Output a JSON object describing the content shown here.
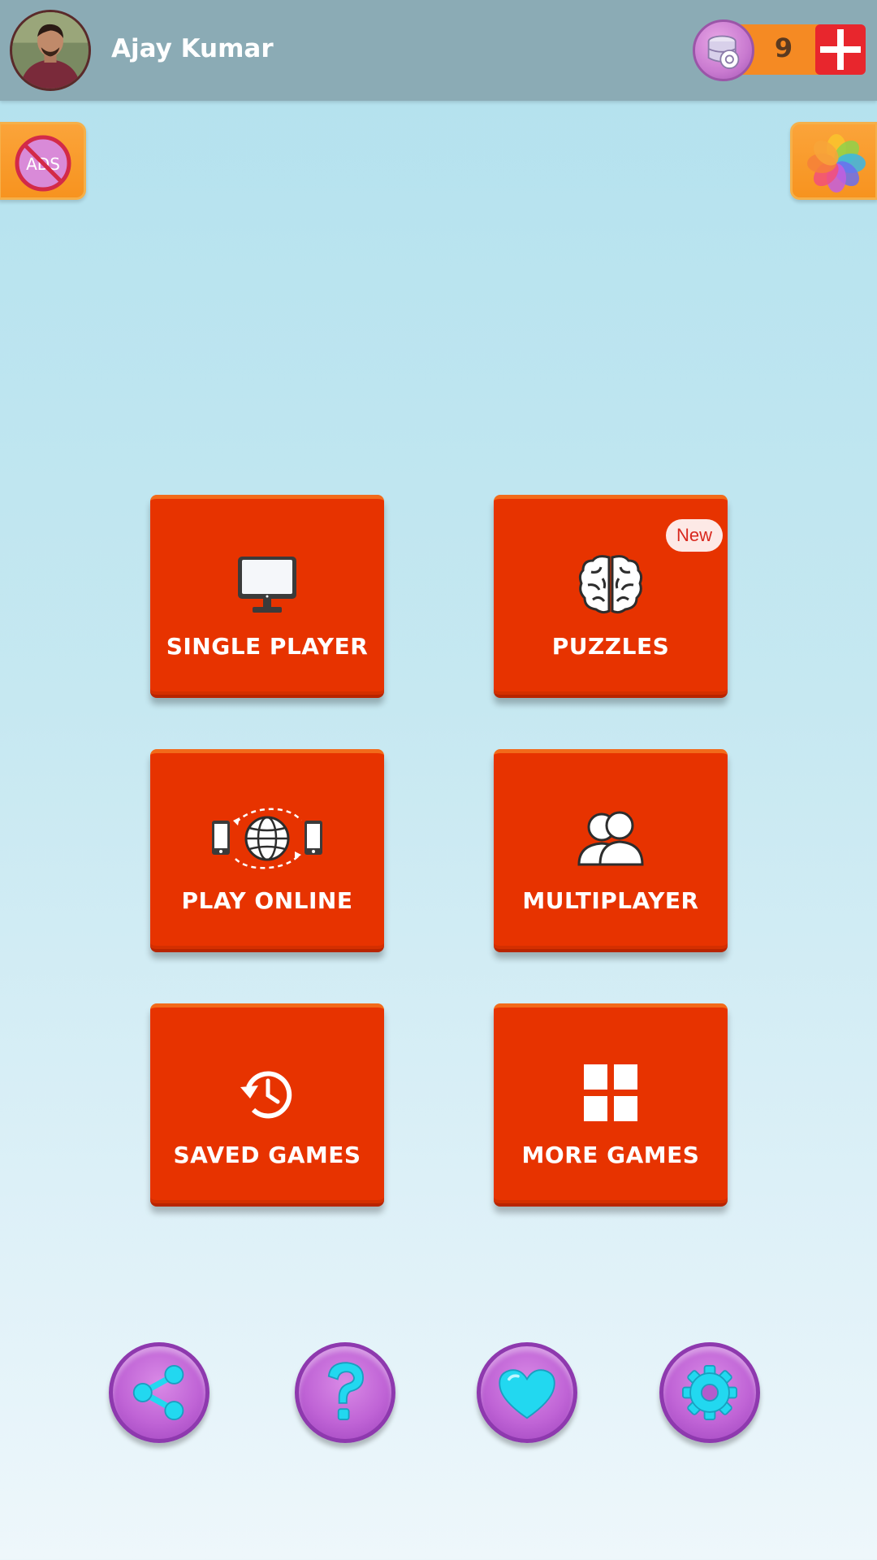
{
  "header": {
    "username": "Ajay Kumar",
    "coins": "9",
    "avatar_icon": "user-photo"
  },
  "top_buttons": {
    "no_ads_icon_text": "ADS",
    "gallery_icon": "flower-gallery-icon"
  },
  "menu": {
    "tiles": [
      {
        "label": "SINGLE PLAYER",
        "icon": "monitor-icon"
      },
      {
        "label": "PUZZLES",
        "icon": "brain-icon",
        "badge": "New"
      },
      {
        "label": "PLAY ONLINE",
        "icon": "globe-devices-icon"
      },
      {
        "label": "MULTIPLAYER",
        "icon": "users-icon"
      },
      {
        "label": "SAVED GAMES",
        "icon": "history-icon"
      },
      {
        "label": "MORE GAMES",
        "icon": "grid-icon"
      }
    ]
  },
  "bottom_bar": {
    "buttons": [
      "share-icon",
      "help-icon",
      "heart-icon",
      "settings-icon"
    ]
  },
  "colors": {
    "header_bg": "#8babb5",
    "tile_bg": "#e73300",
    "accent_orange": "#f7931f",
    "plus_red": "#e8262d",
    "round_btn_purple": "#c064d6",
    "icon_cyan": "#22d8f0"
  }
}
